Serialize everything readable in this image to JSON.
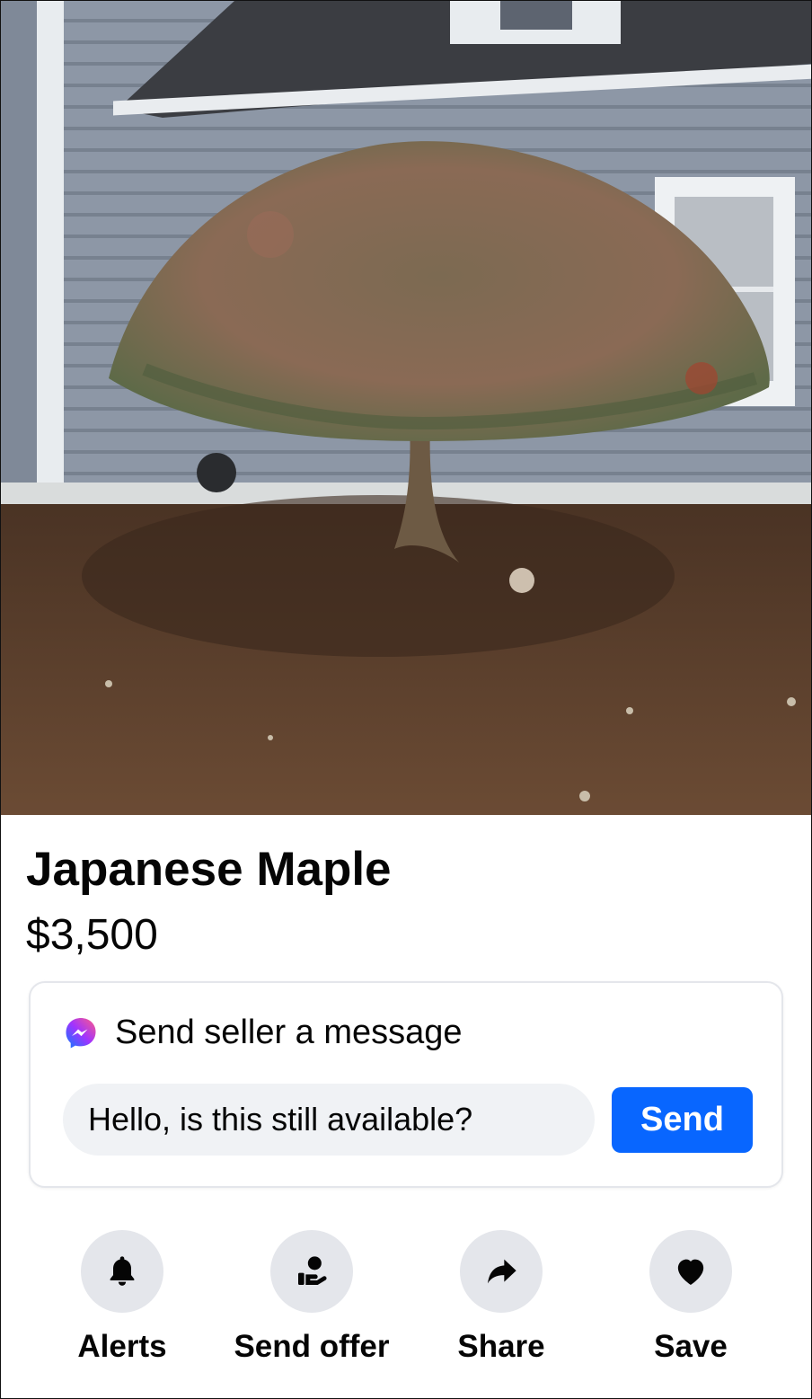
{
  "listing": {
    "title": "Japanese Maple",
    "price": "$3,500",
    "image_icon": "photo-japanese-maple-tree"
  },
  "message_card": {
    "header": "Send seller a message",
    "icon": "messenger-icon",
    "input_value": "Hello, is this still available?",
    "send_label": "Send",
    "send_color": "#0866ff"
  },
  "actions": [
    {
      "label": "Alerts",
      "icon": "bell-icon"
    },
    {
      "label": "Send offer",
      "icon": "offer-hand-icon"
    },
    {
      "label": "Share",
      "icon": "share-arrow-icon"
    },
    {
      "label": "Save",
      "icon": "heart-icon"
    }
  ]
}
